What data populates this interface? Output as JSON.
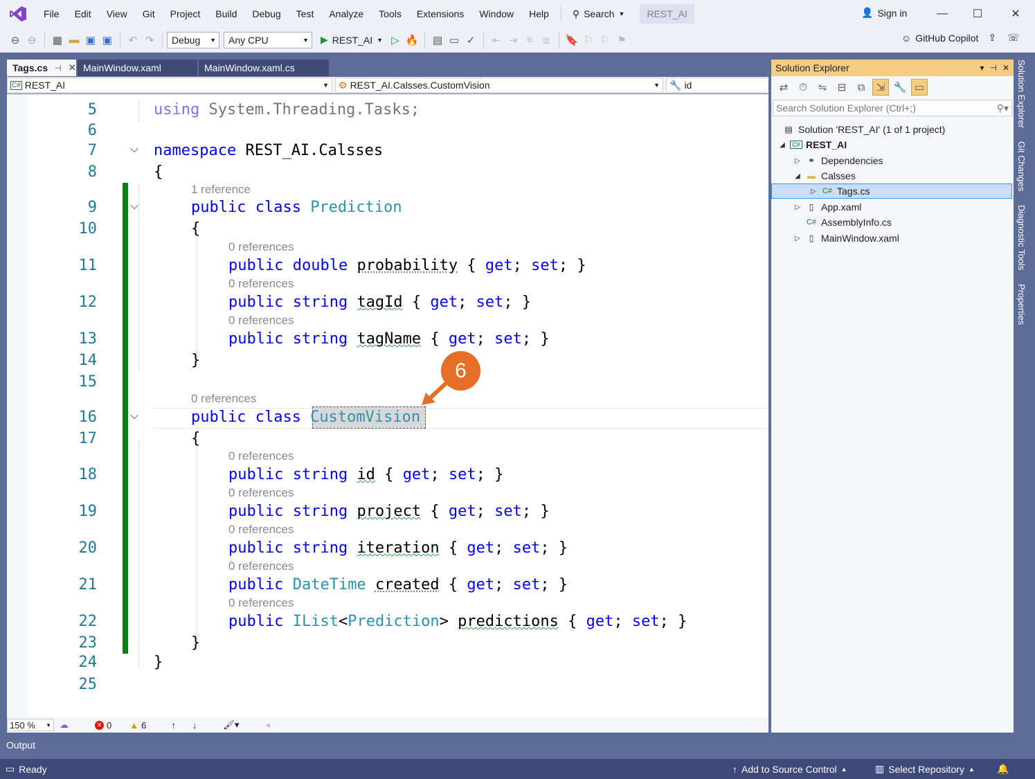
{
  "menu": {
    "items": [
      "File",
      "Edit",
      "View",
      "Git",
      "Project",
      "Build",
      "Debug",
      "Test",
      "Analyze",
      "Tools",
      "Extensions",
      "Window",
      "Help"
    ],
    "search_label": "Search",
    "solution_name": "REST_AI",
    "sign_in": "Sign in"
  },
  "toolbar": {
    "configuration": "Debug",
    "platform": "Any CPU",
    "run_target": "REST_AI",
    "copilot_label": "GitHub Copilot"
  },
  "tabs": [
    {
      "label": "Tags.cs",
      "active": true
    },
    {
      "label": "MainWindow.xaml",
      "active": false
    },
    {
      "label": "MainWindow.xaml.cs",
      "active": false
    }
  ],
  "navbar": {
    "project": "REST_AI",
    "type": "REST_AI.Calsses.CustomVision",
    "member": "id"
  },
  "code": {
    "lines": [
      {
        "n": "5",
        "tokens": [
          [
            "kw",
            "using"
          ],
          [
            "plain",
            " System.Threading.Tasks;"
          ]
        ]
      },
      {
        "n": "6",
        "tokens": []
      },
      {
        "n": "7",
        "tokens": [
          [
            "kw",
            "namespace"
          ],
          [
            "plain",
            " REST_AI.Calsses"
          ]
        ]
      },
      {
        "n": "8",
        "tokens": [
          [
            "plain",
            "{"
          ]
        ]
      },
      {
        "n": "9",
        "lens": "1 reference",
        "tokens": [
          [
            "kw",
            "public class "
          ],
          [
            "ty",
            "Prediction"
          ]
        ]
      },
      {
        "n": "10",
        "tokens": [
          [
            "plain",
            "{"
          ]
        ]
      },
      {
        "n": "11",
        "lens": "0 references",
        "tokens": [
          [
            "kw",
            "public double "
          ],
          [
            "plain",
            "probability"
          ],
          [
            "plain",
            " { "
          ],
          [
            "kw",
            "get"
          ],
          [
            "plain",
            "; "
          ],
          [
            "kw",
            "set"
          ],
          [
            "plain",
            "; }"
          ]
        ]
      },
      {
        "n": "12",
        "lens": "0 references",
        "tokens": [
          [
            "kw",
            "public string "
          ],
          [
            "plain",
            "tagId"
          ],
          [
            "plain",
            " { "
          ],
          [
            "kw",
            "get"
          ],
          [
            "plain",
            "; "
          ],
          [
            "kw",
            "set"
          ],
          [
            "plain",
            "; }"
          ]
        ]
      },
      {
        "n": "13",
        "lens": "0 references",
        "tokens": [
          [
            "kw",
            "public string "
          ],
          [
            "plain",
            "tagName"
          ],
          [
            "plain",
            " { "
          ],
          [
            "kw",
            "get"
          ],
          [
            "plain",
            "; "
          ],
          [
            "kw",
            "set"
          ],
          [
            "plain",
            "; }"
          ]
        ]
      },
      {
        "n": "14",
        "tokens": [
          [
            "plain",
            "}"
          ]
        ]
      },
      {
        "n": "15",
        "tokens": []
      },
      {
        "n": "16",
        "lens": "0 references",
        "tokens": [
          [
            "kw",
            "public class "
          ],
          [
            "ty",
            "CustomVision"
          ]
        ]
      },
      {
        "n": "17",
        "tokens": [
          [
            "plain",
            "{"
          ]
        ]
      },
      {
        "n": "18",
        "lens": "0 references",
        "tokens": [
          [
            "kw",
            "public string "
          ],
          [
            "plain",
            "id"
          ],
          [
            "plain",
            " { "
          ],
          [
            "kw",
            "get"
          ],
          [
            "plain",
            "; "
          ],
          [
            "kw",
            "set"
          ],
          [
            "plain",
            "; }"
          ]
        ]
      },
      {
        "n": "19",
        "lens": "0 references",
        "tokens": [
          [
            "kw",
            "public string "
          ],
          [
            "plain",
            "project"
          ],
          [
            "plain",
            " { "
          ],
          [
            "kw",
            "get"
          ],
          [
            "plain",
            "; "
          ],
          [
            "kw",
            "set"
          ],
          [
            "plain",
            "; }"
          ]
        ]
      },
      {
        "n": "20",
        "lens": "0 references",
        "tokens": [
          [
            "kw",
            "public string "
          ],
          [
            "plain",
            "iteration"
          ],
          [
            "plain",
            " { "
          ],
          [
            "kw",
            "get"
          ],
          [
            "plain",
            "; "
          ],
          [
            "kw",
            "set"
          ],
          [
            "plain",
            "; }"
          ]
        ]
      },
      {
        "n": "21",
        "lens": "0 references",
        "tokens": [
          [
            "kw",
            "public "
          ],
          [
            "ty",
            "DateTime"
          ],
          [
            "plain",
            " created"
          ],
          [
            "plain",
            " { "
          ],
          [
            "kw",
            "get"
          ],
          [
            "plain",
            "; "
          ],
          [
            "kw",
            "set"
          ],
          [
            "plain",
            "; }"
          ]
        ]
      },
      {
        "n": "22",
        "lens": "0 references",
        "tokens": [
          [
            "kw",
            "public "
          ],
          [
            "ty",
            "IList"
          ],
          [
            "plain",
            "<"
          ],
          [
            "ty",
            "Prediction"
          ],
          [
            "plain",
            "> predictions"
          ],
          [
            "plain",
            " { "
          ],
          [
            "kw",
            "get"
          ],
          [
            "plain",
            "; "
          ],
          [
            "kw",
            "set"
          ],
          [
            "plain",
            "; }"
          ]
        ]
      },
      {
        "n": "23",
        "tokens": [
          [
            "plain",
            "}"
          ]
        ]
      },
      {
        "n": "24",
        "tokens": [
          [
            "plain",
            "}"
          ]
        ]
      },
      {
        "n": "25",
        "tokens": []
      }
    ]
  },
  "callout": "6",
  "editor_status": {
    "zoom": "150 %",
    "errors": "0",
    "warnings": "6"
  },
  "solution_explorer": {
    "title": "Solution Explorer",
    "search_placeholder": "Search Solution Explorer (Ctrl+;)",
    "items": [
      {
        "label": "Solution 'REST_AI' (1 of 1 project)"
      },
      {
        "label": "REST_AI"
      },
      {
        "label": "Dependencies"
      },
      {
        "label": "Calsses"
      },
      {
        "label": "Tags.cs"
      },
      {
        "label": "App.xaml"
      },
      {
        "label": "AssemblyInfo.cs"
      },
      {
        "label": "MainWindow.xaml"
      }
    ]
  },
  "side_tabs": [
    "Solution Explorer",
    "Git Changes",
    "Diagnostic Tools",
    "Properties"
  ],
  "output_label": "Output",
  "status": {
    "ready": "Ready",
    "add_source": "Add to Source Control",
    "select_repo": "Select Repository"
  },
  "colors": {
    "chrome": "#5d6b99",
    "accent": "#f5cc84",
    "callout": "#e56f26",
    "changebar": "#108010"
  }
}
